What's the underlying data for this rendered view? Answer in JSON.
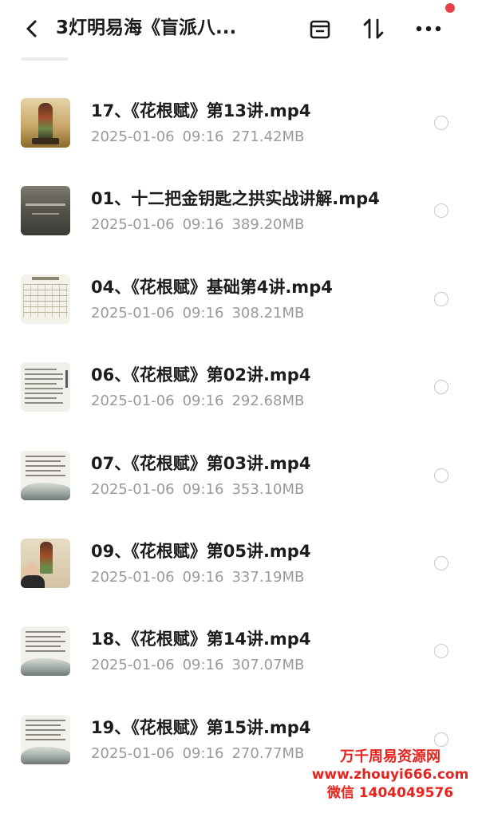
{
  "header": {
    "title": "3灯明易海《盲派八...",
    "back_icon": "chevron-left-icon",
    "actions": [
      "select-box-icon",
      "sort-icon",
      "more-icon"
    ],
    "notification_color": "#e8404a"
  },
  "files": [
    {
      "name": "17、《花根赋》第13讲.mp4",
      "date": "2025-01-06",
      "time": "09:16",
      "size": "271.42MB",
      "thumb": "painting"
    },
    {
      "name": "01、十二把金钥匙之拱实战讲解.mp4",
      "date": "2025-01-06",
      "time": "09:16",
      "size": "389.20MB",
      "thumb": "dark"
    },
    {
      "name": "04、《花根赋》基础第4讲.mp4",
      "date": "2025-01-06",
      "time": "09:16",
      "size": "308.21MB",
      "thumb": "table"
    },
    {
      "name": "06、《花根赋》第02讲.mp4",
      "date": "2025-01-06",
      "time": "09:16",
      "size": "292.68MB",
      "thumb": "text"
    },
    {
      "name": "07、《花根赋》第03讲.mp4",
      "date": "2025-01-06",
      "time": "09:16",
      "size": "353.10MB",
      "thumb": "ink"
    },
    {
      "name": "09、《花根赋》第05讲.mp4",
      "date": "2025-01-06",
      "time": "09:16",
      "size": "337.19MB",
      "thumb": "person"
    },
    {
      "name": "18、《花根赋》第14讲.mp4",
      "date": "2025-01-06",
      "time": "09:16",
      "size": "307.07MB",
      "thumb": "ink"
    },
    {
      "name": "19、《花根赋》第15讲.mp4",
      "date": "2025-01-06",
      "time": "09:16",
      "size": "270.77MB",
      "thumb": "ink"
    }
  ],
  "watermark": {
    "line1": "万千周易资源网",
    "line2": "www.zhouyi666.com",
    "line3": "微信 1404049576",
    "color": "#e8231d"
  }
}
